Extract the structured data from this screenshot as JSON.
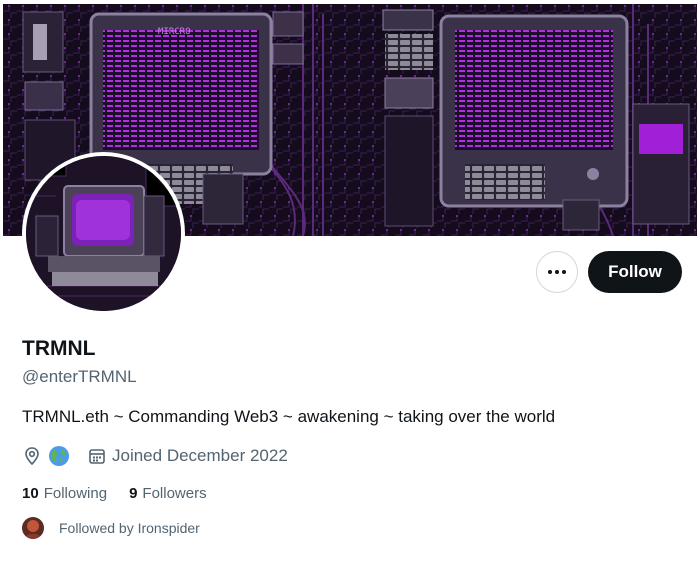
{
  "profile": {
    "display_name": "TRMNL",
    "handle": "@enterTRMNL",
    "bio": "TRMNL.eth ~ Commanding Web3 ~ awakening ~ taking over the world",
    "joined": "Joined December 2022"
  },
  "actions": {
    "follow_label": "Follow",
    "more_icon": "more-horizontal-icon"
  },
  "stats": {
    "following_count": "10",
    "following_label": "Following",
    "followers_count": "9",
    "followers_label": "Followers"
  },
  "followed_by": {
    "text": "Followed by Ironspider"
  },
  "banner": {
    "monitor_text": "MIRCRO"
  },
  "colors": {
    "accent_purple": "#a11fd6",
    "dark_bg": "#120a1a",
    "button_dark": "#0f1419",
    "secondary_text": "#536471",
    "border": "#cfd9de"
  }
}
